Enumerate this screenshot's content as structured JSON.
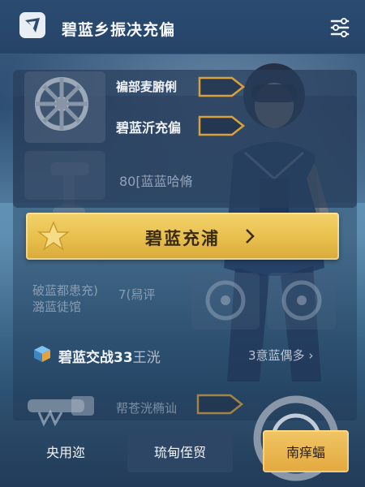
{
  "header": {
    "title": "碧蓝乡振决充偏",
    "logo_icon": "game-logo-icon",
    "menu_icon": "settings-sliders-icon"
  },
  "rows": [
    {
      "label": "褊部麦腑俐",
      "action_icon": "chevron-right-icon"
    },
    {
      "label": "碧蓝沂充偏",
      "action_icon": "chevron-right-icon"
    },
    {
      "label": "80[蓝蓝哈脩"
    }
  ],
  "main_action": {
    "label": "碧蓝充浦",
    "icon": "star-icon",
    "chevron": "›"
  },
  "faded_section": {
    "left_line1": "破蓝都患充)",
    "left_line2": "潞蓝徒馆",
    "mid_text": "7(舄评"
  },
  "info_row": {
    "title": "碧蓝交战",
    "title_suffix": "33",
    "title_tail": "王洸",
    "link": "3意蓝偶多"
  },
  "bottom_row": {
    "label": "帮苍洸椭讪"
  },
  "tabs": [
    {
      "label": "央用迩"
    },
    {
      "label": "琉甸侄贸"
    },
    {
      "label": "南痒蝠"
    }
  ],
  "colors": {
    "header_bg": "#264468",
    "accent_gold": "#e8bf4c",
    "panel_bg": "#283e5c"
  }
}
